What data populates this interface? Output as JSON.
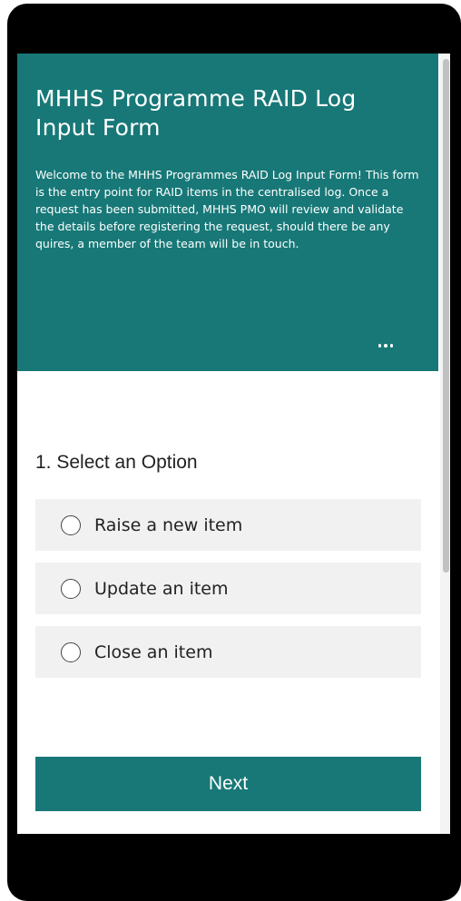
{
  "form": {
    "title": "MHHS Programme RAID Log Input Form",
    "description": "Welcome to the MHHS Programmes RAID Log Input Form! This form is the entry point for RAID items in the centralised log. Once a request has been submitted, MHHS PMO will review and validate the details before registering the request, should there be any quires, a member of the team will be in touch.",
    "more_icon": "ellipsis-icon",
    "theme_color": "#177877"
  },
  "question": {
    "title": "1. Select an Option",
    "options": [
      {
        "label": "Raise a new item"
      },
      {
        "label": "Update an item"
      },
      {
        "label": "Close an item"
      }
    ]
  },
  "actions": {
    "next_label": "Next"
  }
}
